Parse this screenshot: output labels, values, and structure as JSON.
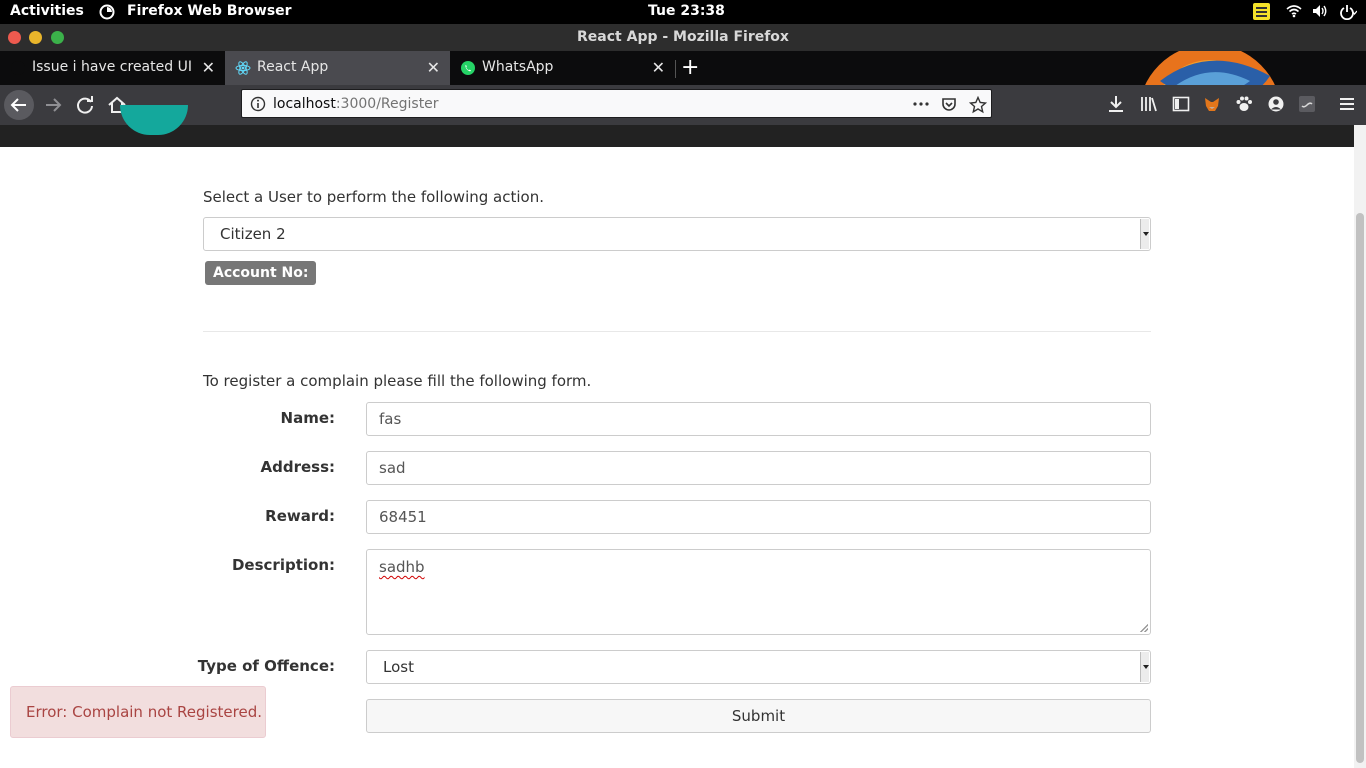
{
  "os": {
    "activities": "Activities",
    "app_name": "Firefox Web Browser",
    "clock": "Tue 23:38"
  },
  "window": {
    "title": "React App - Mozilla Firefox"
  },
  "tabs": [
    {
      "label": "Issue i have created UI but",
      "icon": "github-icon"
    },
    {
      "label": "React App",
      "icon": "react-icon",
      "active": true
    },
    {
      "label": "WhatsApp",
      "icon": "whatsapp-icon"
    }
  ],
  "urlbar": {
    "host": "localhost",
    "rest": ":3000/Register"
  },
  "page": {
    "select_user_prompt": "Select a User to perform the following action.",
    "selected_user": "Citizen 2",
    "account_badge": "Account No:",
    "form_intro": "To register a complain please fill the following form.",
    "form": {
      "name_label": "Name:",
      "name_value": "fas",
      "address_label": "Address:",
      "address_value": "sad",
      "reward_label": "Reward:",
      "reward_value": "68451",
      "description_label": "Description:",
      "description_value": "sadhb",
      "offence_label": "Type of Offence:",
      "offence_value": "Lost",
      "submit_label": "Submit"
    },
    "error_message": "Error: Complain not Registered."
  },
  "colors": {
    "error_bg": "#f2dede",
    "error_text": "#a94442",
    "badge_bg": "#777777",
    "logo_teal": "#14a89c"
  }
}
